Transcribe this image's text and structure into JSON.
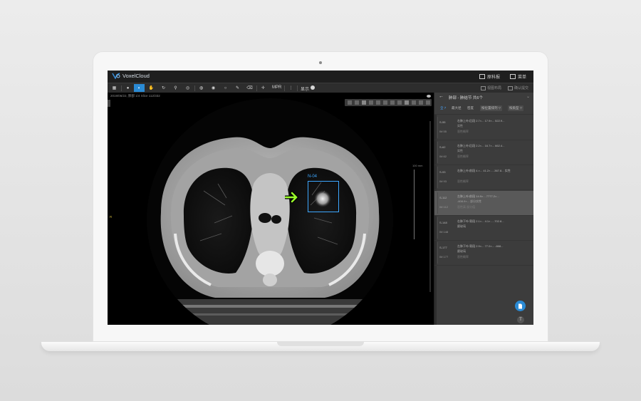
{
  "app": {
    "logo_text": "VoxelCloud",
    "actions": [
      {
        "label": "原科报"
      },
      {
        "label": "菜单"
      }
    ]
  },
  "toolbar": {
    "mpr_label": "MPR",
    "toggle_label": "显示",
    "right_actions": [
      {
        "label": "视图布局"
      },
      {
        "label": "确认提交"
      }
    ]
  },
  "viewer": {
    "info": "2019/06/22, 肺部 1/4 Slice 112/332",
    "orient_top": "A",
    "orient_left": "R",
    "ruler_label": "100 mm",
    "nodule_label": "N-04"
  },
  "panel": {
    "title": "肺部 - 肺结节 共6个",
    "tabs": [
      "全 7",
      "最大径",
      "密度",
      "按位置排列 ▽",
      "按类型 ▽"
    ],
    "items": [
      {
        "slice": "S-55",
        "im": "IM 55",
        "line1": "右肺上叶/后段 2.7×... 17.9×... 522.9...",
        "line2": "实性",
        "line3": "恶性概率"
      },
      {
        "slice": "S-62",
        "im": "IM 62",
        "line1": "右肺上叶/后段 2.2×... 16.7×... 662.4...",
        "line2": "实性",
        "line3": "恶性概率"
      },
      {
        "slice": "S-93",
        "im": "IM 93",
        "line1": "右肺上叶/前段 4.×... 41.2×... -367.8... 实性",
        "line2": "",
        "line3": "恶性概率"
      },
      {
        "slice": "S-112",
        "im": "IM 112",
        "line1": "左肺上叶/前段 14.9×... 7777.2×...",
        "line2": "-608.9×... 部分实性",
        "line3": "恶性高  部分值"
      },
      {
        "slice": "S-148",
        "im": "IM 148",
        "line1": "右肺下叶/背段 2.1×... 4.1×... -702.8...",
        "line2": "磨玻璃",
        "line3": ""
      },
      {
        "slice": "S-177",
        "im": "IM 177",
        "line1": "左肺下叶/背段 2.9×... 77.0×... -668...",
        "line2": "磨玻璃",
        "line3": "恶性概率"
      }
    ]
  },
  "colors": {
    "accent": "#2a8ad4",
    "nodule_box": "#3da7ff",
    "arrow": "#9aff2a"
  }
}
